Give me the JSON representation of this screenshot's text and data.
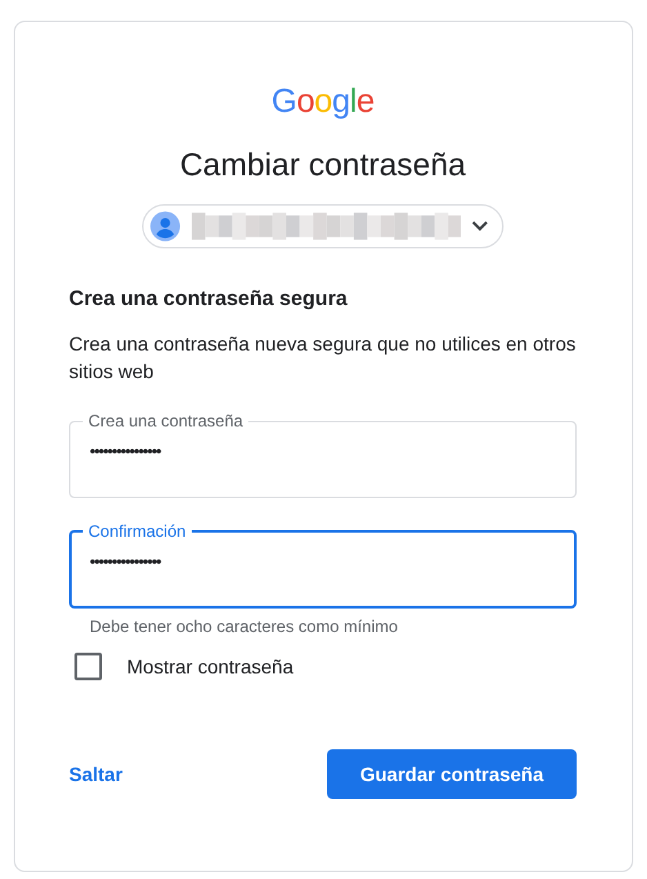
{
  "logo": "Google",
  "title": "Cambiar contraseña",
  "account_chip": {
    "expanded": false
  },
  "heading": "Crea una contraseña segura",
  "description": "Crea una contraseña nueva segura que no utilices en otros sitios web",
  "fields": [
    {
      "label": "Crea una contraseña",
      "value": "••••••••••••••••",
      "focused": false
    },
    {
      "label": "Confirmación",
      "value": "••••••••••••••••",
      "focused": true
    }
  ],
  "helper": "Debe tener ocho caracteres como mínimo",
  "show_password": {
    "label": "Mostrar contraseña",
    "checked": false
  },
  "skip_link": "Saltar",
  "submit_button": "Guardar contraseña"
}
